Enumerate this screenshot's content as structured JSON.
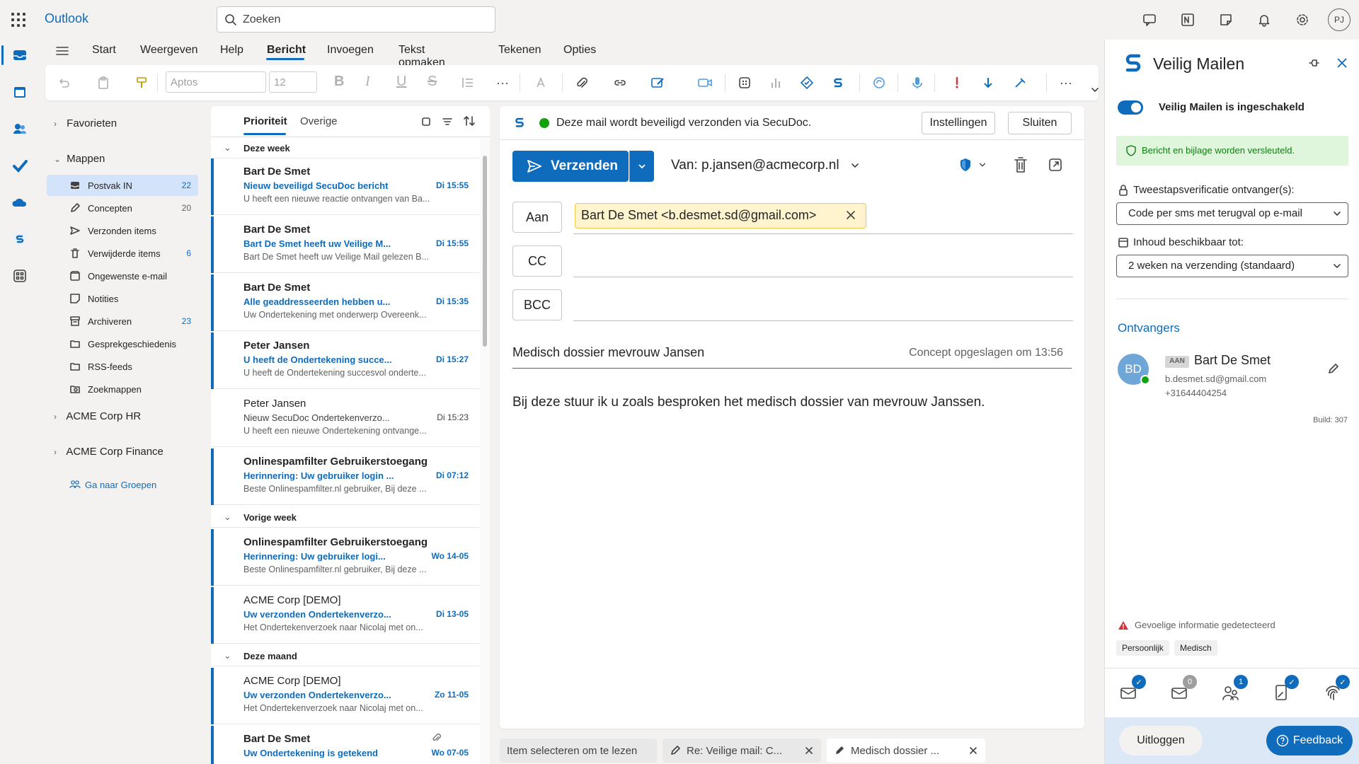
{
  "app": {
    "title": "Outlook",
    "user_initials": "PJ"
  },
  "search": {
    "placeholder": "Zoeken"
  },
  "ribbon": {
    "tabs": [
      "Start",
      "Weergeven",
      "Help",
      "Bericht",
      "Invoegen",
      "Tekst opmaken",
      "Tekenen",
      "Opties"
    ],
    "active_tab": "Bericht",
    "font_name": "Aptos",
    "font_size": "12"
  },
  "folders": {
    "favorites": "Favorieten",
    "mappen": "Mappen",
    "items": [
      {
        "label": "Postvak IN",
        "count": "22",
        "icon": "inbox-icon"
      },
      {
        "label": "Concepten",
        "count": "20",
        "icon": "draft-icon"
      },
      {
        "label": "Verzonden items",
        "count": "",
        "icon": "send-icon"
      },
      {
        "label": "Verwijderde items",
        "count": "6",
        "icon": "trash-icon"
      },
      {
        "label": "Ongewenste e-mail",
        "count": "",
        "icon": "junk-icon"
      },
      {
        "label": "Notities",
        "count": "",
        "icon": "note-icon"
      },
      {
        "label": "Archiveren",
        "count": "23",
        "icon": "archive-icon"
      },
      {
        "label": "Gesprekgeschiedenis",
        "count": "",
        "icon": "folder-icon"
      },
      {
        "label": "RSS-feeds",
        "count": "",
        "icon": "folder-icon"
      },
      {
        "label": "Zoekmappen",
        "count": "",
        "icon": "search-folder-icon"
      }
    ],
    "groups": [
      "ACME Corp HR",
      "ACME Corp Finance"
    ],
    "goto_groups": "Ga naar Groepen"
  },
  "message_list": {
    "tab_focused": "Prioriteit",
    "tab_other": "Overige",
    "groups": [
      "Deze week",
      "Vorige week",
      "Deze maand"
    ],
    "messages": [
      {
        "from": "Bart De Smet",
        "subject": "Nieuw beveiligd SecuDoc bericht",
        "time": "Di 15:55",
        "preview": "U heeft een nieuwe reactie ontvangen van Ba..."
      },
      {
        "from": "Bart De Smet",
        "subject": "Bart De Smet heeft uw Veilige M...",
        "time": "Di 15:55",
        "preview": "Bart De Smet heeft uw Veilige Mail gelezen B..."
      },
      {
        "from": "Bart De Smet",
        "subject": "Alle geaddresseerden hebben u...",
        "time": "Di 15:35",
        "preview": "Uw Ondertekening met onderwerp Overeenk..."
      },
      {
        "from": "Peter Jansen",
        "subject": "U heeft de Ondertekening succe...",
        "time": "Di 15:27",
        "preview": "U heeft de Ondertekening succesvol onderte..."
      },
      {
        "from": "Peter Jansen",
        "subject": "Nieuw SecuDoc Ondertekenverzo...",
        "time": "Di 15:23",
        "preview": "U heeft een nieuwe Ondertekening ontvange..."
      },
      {
        "from": "Onlinespamfilter Gebruikerstoegang",
        "subject": "Herinnering: Uw gebruiker login ...",
        "time": "Di 07:12",
        "preview": "Beste Onlinespamfilter.nl gebruiker, Bij deze ..."
      },
      {
        "from": "Onlinespamfilter Gebruikerstoegang",
        "subject": "Herinnering: Uw gebruiker logi...",
        "time": "Wo 14-05",
        "preview": "Beste Onlinespamfilter.nl gebruiker, Bij deze ..."
      },
      {
        "from": "ACME Corp [DEMO]",
        "subject": "Uw verzonden Ondertekenverzo...",
        "time": "Di 13-05",
        "preview": "Het Ondertekenverzoek naar Nicolaj met on..."
      },
      {
        "from": "ACME Corp [DEMO]",
        "subject": "Uw verzonden Ondertekenverzo...",
        "time": "Zo 11-05",
        "preview": "Het Ondertekenverzoek naar Nicolaj met on..."
      },
      {
        "from": "Bart De Smet",
        "subject": "Uw Ondertekening is getekend",
        "time": "Wo 07-05",
        "preview": ""
      }
    ]
  },
  "compose": {
    "secudoc_banner": "Deze mail wordt beveiligd verzonden via SecuDoc.",
    "settings_btn": "Instellingen",
    "close_btn": "Sluiten",
    "send_btn": "Verzenden",
    "from": "Van: p.jansen@acmecorp.nl",
    "to_label": "Aan",
    "cc_label": "CC",
    "bcc_label": "BCC",
    "to_recipient": "Bart De Smet <b.desmet.sd@gmail.com>",
    "subject": "Medisch dossier mevrouw Jansen",
    "draft_saved": "Concept opgeslagen om 13:56",
    "body": "Bij deze stuur ik u zoals besproken het medisch dossier van mevrouw Janssen."
  },
  "bottom_tabs": [
    "Item selecteren om te lezen",
    "Re: Veilige mail: C...",
    "Medisch dossier ..."
  ],
  "addin": {
    "title": "Veilig Mailen",
    "toggle_label": "Veilig Mailen is ingeschakeld",
    "success": "Bericht en bijlage worden versleuteld.",
    "twofa_label": "Tweestapsverificatie ontvanger(s):",
    "twofa_value": "Code per sms met terugval op e-mail",
    "available_label": "Inhoud beschikbaar tot:",
    "available_value": "2 weken na verzending (standaard)",
    "recipients_title": "Ontvangers",
    "recipient": {
      "initials": "BD",
      "badge": "AAN",
      "name": "Bart De Smet",
      "email": "b.desmet.sd@gmail.com",
      "phone": "+31644404254"
    },
    "build": "Build: 307",
    "warning": "Gevoelige informatie gedetecteerd",
    "tags": [
      "Persoonlijk",
      "Medisch"
    ],
    "footer_badges": [
      "0",
      "1"
    ],
    "logout": "Uitloggen",
    "feedback": "Feedback"
  },
  "colors": {
    "accent": "#0f6cbd",
    "success_bg": "#dff6dd",
    "chip_bg": "#fff4ce",
    "warning": "#d13438"
  }
}
